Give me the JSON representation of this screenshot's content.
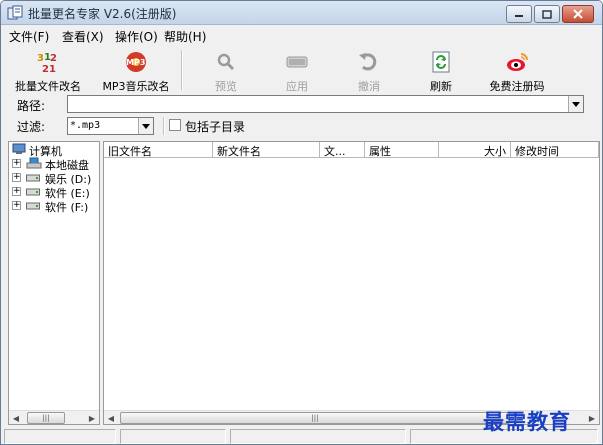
{
  "window": {
    "title": "批量更名专家 V2.6(注册版)"
  },
  "menu": [
    {
      "label": "文件(F)"
    },
    {
      "label": "查看(X)"
    },
    {
      "label": "操作(O)"
    },
    {
      "label": "帮助(H)"
    }
  ],
  "toolbar": {
    "buttons": [
      {
        "label": "批量文件改名",
        "icon": "numbers-icon",
        "disabled": false
      },
      {
        "label": "MP3音乐改名",
        "icon": "mp3-icon",
        "disabled": false
      },
      {
        "label": "预览",
        "icon": "magnifier-icon",
        "disabled": true
      },
      {
        "label": "应用",
        "icon": "apply-icon",
        "disabled": true
      },
      {
        "label": "撤消",
        "icon": "undo-icon",
        "disabled": true
      },
      {
        "label": "刷新",
        "icon": "refresh-icon",
        "disabled": false
      },
      {
        "label": "免费注册码",
        "icon": "weibo-icon",
        "disabled": false
      }
    ]
  },
  "path": {
    "label": "路径:",
    "value": ""
  },
  "filter": {
    "label": "过滤:",
    "value": "*.mp3",
    "include_subdirs_label": "包括子目录",
    "include_subdirs": false
  },
  "tree": {
    "root": "计算机",
    "items": [
      {
        "label": "本地磁盘"
      },
      {
        "label": "娱乐 (D:)"
      },
      {
        "label": "软件 (E:)"
      },
      {
        "label": "软件 (F:)"
      }
    ]
  },
  "filelist": {
    "columns": [
      "旧文件名",
      "新文件名",
      "文...",
      "属性",
      "大小",
      "修改时间"
    ],
    "rows": []
  },
  "watermark": "最需教育",
  "colors": {
    "title_gradient_top": "#dbe6f3",
    "close_button": "#c44d32",
    "watermark": "#1a3fc4"
  }
}
